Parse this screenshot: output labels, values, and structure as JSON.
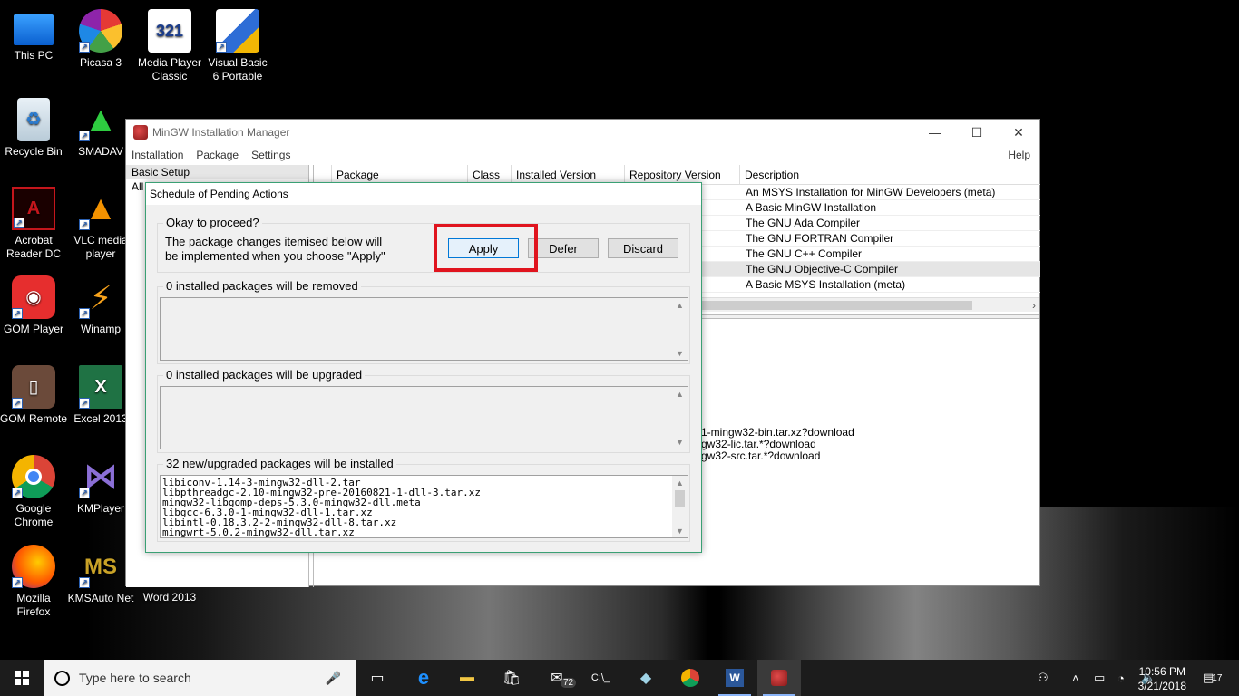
{
  "desktop": {
    "icons": [
      {
        "label": "This PC"
      },
      {
        "label": "Picasa 3"
      },
      {
        "label": "Media Player Classic"
      },
      {
        "label": "Visual Basic 6 Portable"
      },
      {
        "label": "Recycle Bin"
      },
      {
        "label": "SMADAV"
      },
      {
        "label": "Acrobat Reader DC"
      },
      {
        "label": "VLC media player"
      },
      {
        "label": "GOM Player"
      },
      {
        "label": "Winamp"
      },
      {
        "label": "GOM Remote"
      },
      {
        "label": "Excel 2013"
      },
      {
        "label": "Google Chrome"
      },
      {
        "label": "KMPlayer"
      },
      {
        "label": "Mozilla Firefox"
      },
      {
        "label": "KMSAuto Net"
      },
      {
        "label": "Word 2013"
      }
    ]
  },
  "window": {
    "title": "MinGW Installation Manager",
    "menu": [
      "Installation",
      "Package",
      "Settings"
    ],
    "help": "Help",
    "left_items": [
      "Basic Setup",
      "All"
    ],
    "columns": [
      "Package",
      "Class",
      "Installed Version",
      "Repository Version",
      "Description"
    ],
    "descriptions": [
      "An MSYS Installation for MinGW Developers (meta)",
      "A Basic MinGW Installation",
      "The GNU Ada Compiler",
      "The GNU FORTRAN Compiler",
      "The GNU C++ Compiler",
      "The GNU Objective-C Compiler",
      "A Basic MSYS Installation (meta)"
    ],
    "detail_lines": [
      "1-mingw32-bin.tar.xz?download",
      "gw32-lic.tar.*?download",
      "gw32-src.tar.*?download"
    ]
  },
  "dialog": {
    "title": "Schedule of Pending Actions",
    "proceed_label": "Okay to proceed?",
    "proceed_text_1": "The package changes itemised below will",
    "proceed_text_2": "be implemented when you choose \"Apply\"",
    "apply": "Apply",
    "defer": "Defer",
    "discard": "Discard",
    "removed_label": "0 installed packages will be removed",
    "upgraded_label": "0 installed packages will be upgraded",
    "installed_label": "32 new/upgraded packages will be installed",
    "packages": [
      "libiconv-1.14-3-mingw32-dll-2.tar",
      "libpthreadgc-2.10-mingw32-pre-20160821-1-dll-3.tar.xz",
      "mingw32-libgomp-deps-5.3.0-mingw32-dll.meta",
      "libgcc-6.3.0-1-mingw32-dll-1.tar.xz",
      "libintl-0.18.3.2-2-mingw32-dll-8.tar.xz",
      "mingwrt-5.0.2-mingw32-dll.tar.xz"
    ]
  },
  "taskbar": {
    "search_placeholder": "Type here to search",
    "mail_badge": "72",
    "time": "10:56 PM",
    "date": "3/21/2018",
    "notif_count": "17"
  }
}
